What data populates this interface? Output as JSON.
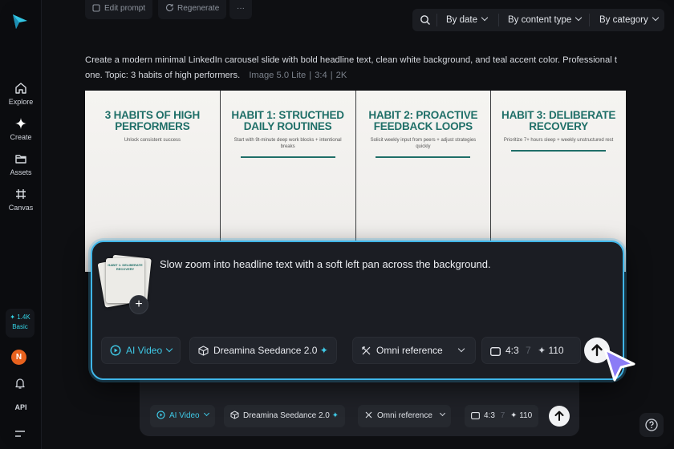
{
  "sidebar": {
    "items": [
      {
        "label": "Explore",
        "icon": "home-icon"
      },
      {
        "label": "Create",
        "icon": "sparkle-icon"
      },
      {
        "label": "Assets",
        "icon": "folder-icon"
      },
      {
        "label": "Canvas",
        "icon": "canvas-icon"
      }
    ],
    "credits_value": "✦ 1.4K",
    "plan": "Basic",
    "avatar_initial": "N",
    "api_label": "API"
  },
  "top_actions": {
    "edit_prompt": "Edit prompt",
    "regenerate": "Regenerate",
    "more": "···"
  },
  "filters": {
    "date": "By date",
    "content_type": "By content type",
    "category": "By category"
  },
  "generation": {
    "prompt": "Create a modern minimal LinkedIn carousel slide with bold headline text, clean white background, and teal accent color. Professional t one. Topic: 3 habits of high performers.",
    "model": "Image 5.0 Lite",
    "ratio": "3:4",
    "resolution": "2K",
    "slides": [
      {
        "title": "3 HABITS OF HIGH PERFORMERS",
        "subtitle": "Unlock consistent success"
      },
      {
        "title": "HABIT 1: STRUCTHED DAILY ROUTINES",
        "subtitle": "Start with 9t-minute deep work blocks + intentional breaks"
      },
      {
        "title": "HABIT 2: PROACTIVE FEEDBACK LOOPS",
        "subtitle": "Solicit weekly input from peers + adjust strategies quickly"
      },
      {
        "title": "HABIT 3: DELIBERATE RECOVERY",
        "subtitle": "Prioritize 7+ hours sleep + weekly unstructured rest"
      }
    ]
  },
  "composer": {
    "thumb_text": "HABIT 1: DELIBERATE RECOVERY",
    "add_label": "+",
    "prompt_text": "Slow zoom into headline text with a soft left pan across the background.",
    "mode": "AI Video",
    "model": "Dreamina Seedance 2.0",
    "reference": "Omni reference",
    "ratio": "4:3",
    "duration": "7",
    "cost": "110",
    "accent_color": "#3fb5e8"
  },
  "ghost_composer": {
    "mode": "AI Video",
    "model": "Dreamina Seedance 2.0",
    "reference": "Omni reference",
    "ratio": "4:3",
    "duration": "7",
    "cost": "110"
  }
}
